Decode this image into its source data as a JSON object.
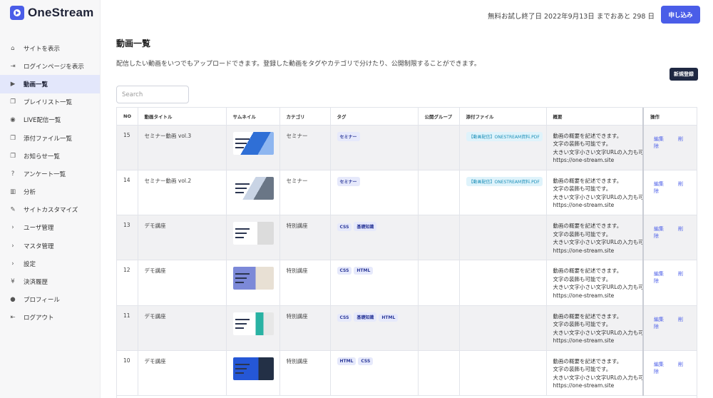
{
  "app": {
    "logo_text": "OneStream",
    "brand_color": "#4a5de8"
  },
  "header": {
    "trial_text": "無料お試し終了日 2022年9月13日 までおあと 298 日",
    "apply_label": "申し込み"
  },
  "sidebar": {
    "items": [
      {
        "label": "サイトを表示",
        "icon": "home-icon",
        "glyph": "⌂",
        "active": false
      },
      {
        "label": "ログインページを表示",
        "icon": "login-icon",
        "glyph": "⇥",
        "active": false
      },
      {
        "label": "動画一覧",
        "icon": "video-icon",
        "glyph": "▶",
        "active": true
      },
      {
        "label": "プレイリスト一覧",
        "icon": "playlist-icon",
        "glyph": "❐",
        "active": false
      },
      {
        "label": "LIVE配信一覧",
        "icon": "live-icon",
        "glyph": "◉",
        "active": false
      },
      {
        "label": "添付ファイル一覧",
        "icon": "attachment-icon",
        "glyph": "❐",
        "active": false
      },
      {
        "label": "お知らせ一覧",
        "icon": "notice-icon",
        "glyph": "❐",
        "active": false
      },
      {
        "label": "アンケート一覧",
        "icon": "survey-icon",
        "glyph": "?",
        "active": false
      },
      {
        "label": "分析",
        "icon": "analytics-icon",
        "glyph": "▥",
        "active": false
      },
      {
        "label": "サイトカスタマイズ",
        "icon": "edit-icon",
        "glyph": "✎",
        "active": false
      },
      {
        "label": "ユーザ管理",
        "icon": "chevron-right-icon",
        "glyph": "›",
        "active": false
      },
      {
        "label": "マスタ管理",
        "icon": "chevron-right-icon",
        "glyph": "›",
        "active": false
      },
      {
        "label": "設定",
        "icon": "chevron-right-icon",
        "glyph": "›",
        "active": false
      },
      {
        "label": "決済履歴",
        "icon": "yen-icon",
        "glyph": "¥",
        "active": false
      },
      {
        "label": "プロフィール",
        "icon": "user-icon",
        "glyph": "●",
        "active": false
      },
      {
        "label": "ログアウト",
        "icon": "logout-icon",
        "glyph": "⇤",
        "active": false
      }
    ]
  },
  "main": {
    "title": "動画一覧",
    "description": "配信したい動画をいつでもアップロードできます。登録した動画をタグやカテゴリで分けたり、公開制限することができます。",
    "new_button": "新規登録",
    "search_placeholder": "Search",
    "columns": [
      "NO",
      "動画タイトル",
      "サムネイル",
      "カテゴリ",
      "タグ",
      "公開グループ",
      "添付ファイル",
      "概要",
      "操作"
    ],
    "edit_label": "編集",
    "delete_label": "削除",
    "rows": [
      {
        "no": "15",
        "title": "セミナー動画 vol.3",
        "thumb": "t1",
        "category": "セミナー",
        "tags": [
          "セミナー"
        ],
        "group": "",
        "file": "【動画配信】ONESTREAM資料.PDF",
        "summary": [
          "動画の概要を記述できます。",
          "文字の装飾も可能です。",
          "大きい文字小さい文字URLの入力も可能です",
          "https://one-stream.site"
        ]
      },
      {
        "no": "14",
        "title": "セミナー動画 vol.2",
        "thumb": "t2",
        "category": "セミナー",
        "tags": [
          "セミナー"
        ],
        "group": "",
        "file": "【動画配信】ONESTREAM資料.PDF",
        "summary": [
          "動画の概要を記述できます。",
          "文字の装飾も可能です。",
          "大きい文字小さい文字URLの入力も可能です",
          "https://one-stream.site"
        ]
      },
      {
        "no": "13",
        "title": "デモ講座",
        "thumb": "t3",
        "category": "特別講座",
        "tags": [
          "CSS",
          "基礎知識"
        ],
        "group": "",
        "file": "",
        "summary": [
          "動画の概要を記述できます。",
          "文字の装飾も可能です。",
          "大きい文字小さい文字URLの入力も可能です",
          "https://one-stream.site"
        ]
      },
      {
        "no": "12",
        "title": "デモ講座",
        "thumb": "t4",
        "category": "特別講座",
        "tags": [
          "CSS",
          "HTML"
        ],
        "group": "",
        "file": "",
        "summary": [
          "動画の概要を記述できます。",
          "文字の装飾も可能です。",
          "大きい文字小さい文字URLの入力も可能です",
          "https://one-stream.site"
        ]
      },
      {
        "no": "11",
        "title": "デモ講座",
        "thumb": "t5",
        "category": "特別講座",
        "tags": [
          "CSS",
          "基礎知識",
          "HTML"
        ],
        "group": "",
        "file": "",
        "summary": [
          "動画の概要を記述できます。",
          "文字の装飾も可能です。",
          "大きい文字小さい文字URLの入力も可能です",
          "https://one-stream.site"
        ]
      },
      {
        "no": "10",
        "title": "デモ講座",
        "thumb": "t6",
        "category": "特別講座",
        "tags": [
          "HTML",
          "CSS"
        ],
        "group": "",
        "file": "",
        "summary": [
          "動画の概要を記述できます。",
          "文字の装飾も可能です。",
          "大きい文字小さい文字URLの入力も可能です",
          "https://one-stream.site"
        ]
      }
    ]
  }
}
